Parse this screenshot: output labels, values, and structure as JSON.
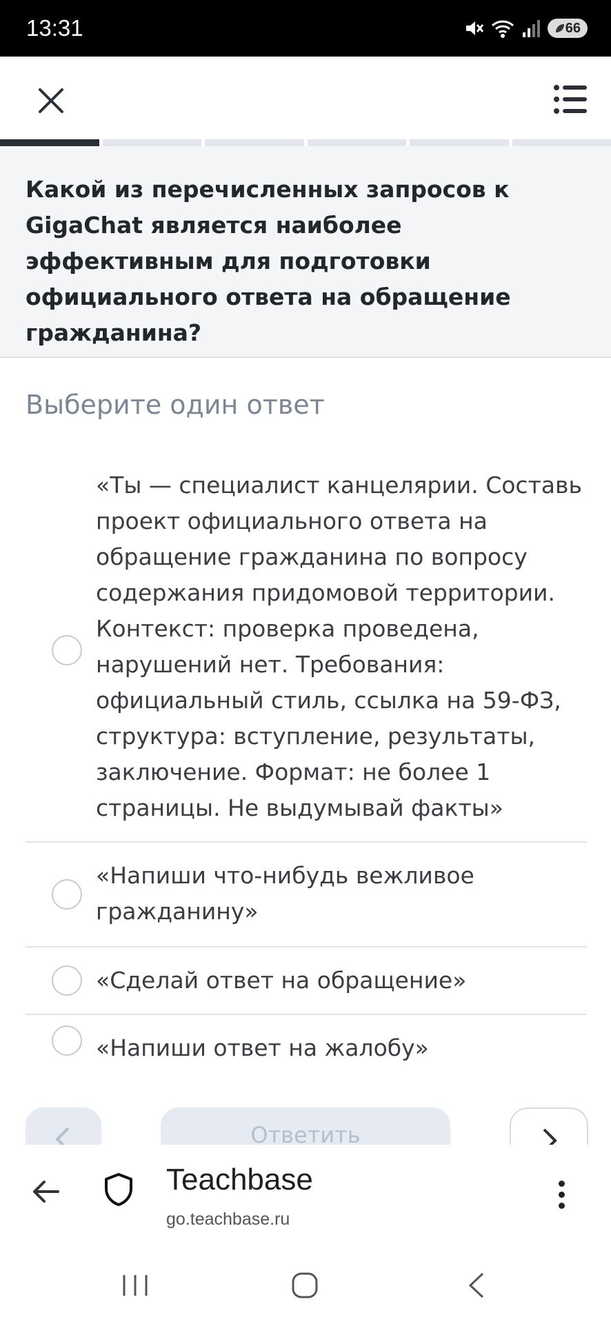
{
  "status_bar": {
    "time": "13:31",
    "battery": "66"
  },
  "icons": {
    "close": "close-icon",
    "menu": "list-menu-icon",
    "back": "back-arrow-icon",
    "shield": "shield-icon",
    "more": "kebab-menu-icon"
  },
  "progress": {
    "total_steps": 6,
    "current_step": 1
  },
  "question": {
    "text": "Какой из перечисленных запросов к GigaChat является наиболее эффективным для подготовки официального ответа на обращение гражданина?"
  },
  "hint": "Выберите один ответ",
  "options": [
    {
      "text": "«Ты — специалист канцелярии. Составь проект официального ответа на обращение гражданина по вопросу содержания придомовой территории. Контекст: проверка проведена, нарушений нет. Требования: официальный стиль, ссылка на 59-ФЗ, структура: вступление, результаты, заключение. Формат: не более 1 страницы. Не выдумывай факты»"
    },
    {
      "text": "«Напиши что-нибудь вежливое гражданину»"
    },
    {
      "text": "«Сделай ответ на обращение»"
    },
    {
      "text": "«Напиши ответ на жалобу»"
    }
  ],
  "actions": {
    "submit_label": "Ответить"
  },
  "browser": {
    "title": "Teachbase",
    "url": "go.teachbase.ru"
  },
  "colors": {
    "progress_active": "#2b2f36",
    "progress_inactive": "#e2e5ea",
    "question_bg": "#f4f5f7",
    "hint": "#7c8694",
    "button_bg": "#e6ebf3"
  }
}
